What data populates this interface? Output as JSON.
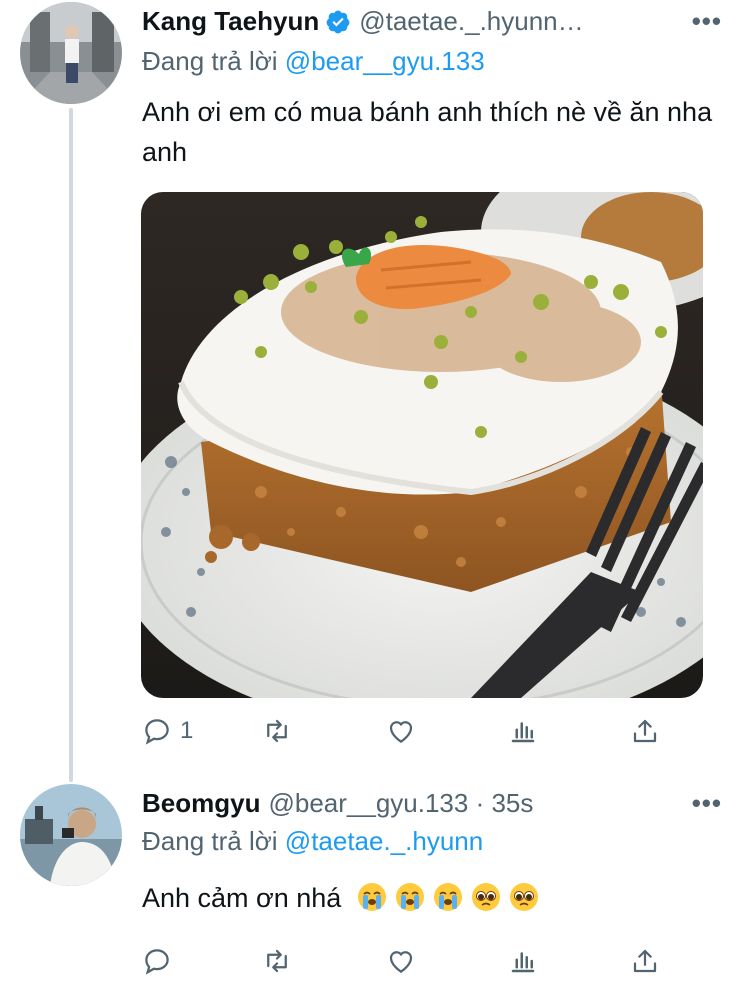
{
  "tweet1": {
    "name": "Kang Taehyun",
    "verified": true,
    "handle": "@taetae._.hyunn…",
    "more": "•••",
    "replying_prefix": "Đang trả lời",
    "replying_to": "@bear__gyu.133",
    "text": "Anh ơi em có mua bánh anh thích nè về ăn nha anh",
    "media_icon": "carrot-cake-photo",
    "actions": {
      "reply_count": "1",
      "retweet_count": "",
      "like_count": ""
    }
  },
  "tweet2": {
    "name": "Beomgyu",
    "handle": "@bear__gyu.133 · 35s",
    "more": "•••",
    "replying_prefix": "Đang trả lời",
    "replying_to": "@taetae._.hyunn",
    "text": "Anh cảm ơn nhá",
    "emojis": [
      "crying-face",
      "crying-face",
      "crying-face",
      "pleading-face",
      "pleading-face"
    ]
  },
  "colors": {
    "text": "#0f1419",
    "muted": "#536471",
    "link": "#1d9bf0",
    "thread_line": "#cfd9de"
  }
}
